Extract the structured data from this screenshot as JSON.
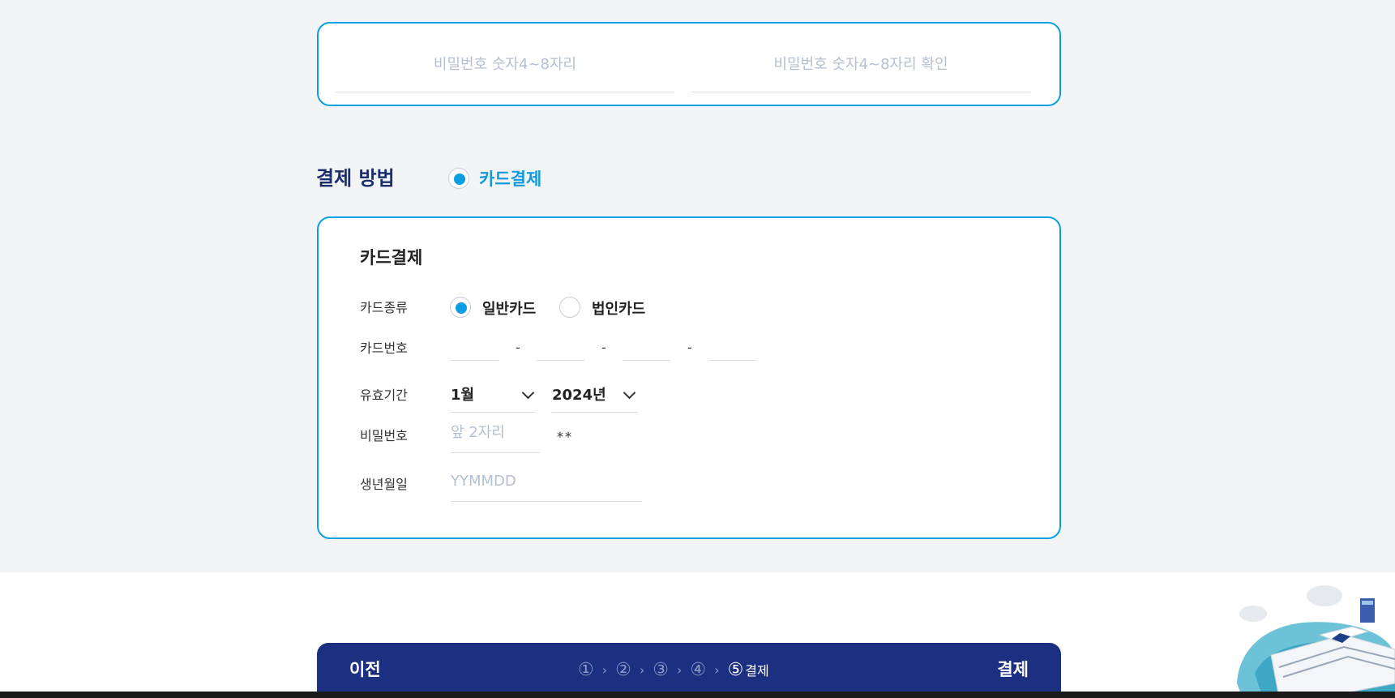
{
  "password": {
    "placeholder": "비밀번호 숫자4~8자리",
    "confirm_placeholder": "비밀번호 숫자4~8자리 확인"
  },
  "payment_method": {
    "title": "결제 방법",
    "option_label": "카드결제",
    "selected": true
  },
  "card_form": {
    "title": "카드결제",
    "card_type": {
      "label": "카드종류",
      "options": [
        {
          "label": "일반카드",
          "selected": true
        },
        {
          "label": "법인카드",
          "selected": false
        }
      ]
    },
    "card_number": {
      "label": "카드번호",
      "separator": "-"
    },
    "expiry": {
      "label": "유효기간",
      "month": "1월",
      "year": "2024년"
    },
    "password": {
      "label": "비밀번호",
      "placeholder": "앞 2자리",
      "mask": "**"
    },
    "birth": {
      "label": "생년월일",
      "placeholder": "YYMMDD"
    }
  },
  "bottom_nav": {
    "prev_label": "이전",
    "next_label": "결제",
    "steps": [
      "①",
      "②",
      "③",
      "④"
    ],
    "current_step": "⑤",
    "current_step_label": "결제",
    "step_separator": "›"
  },
  "colors": {
    "accent": "#0aa0e0",
    "navy": "#1c2f80",
    "heading": "#1a2e6e"
  }
}
